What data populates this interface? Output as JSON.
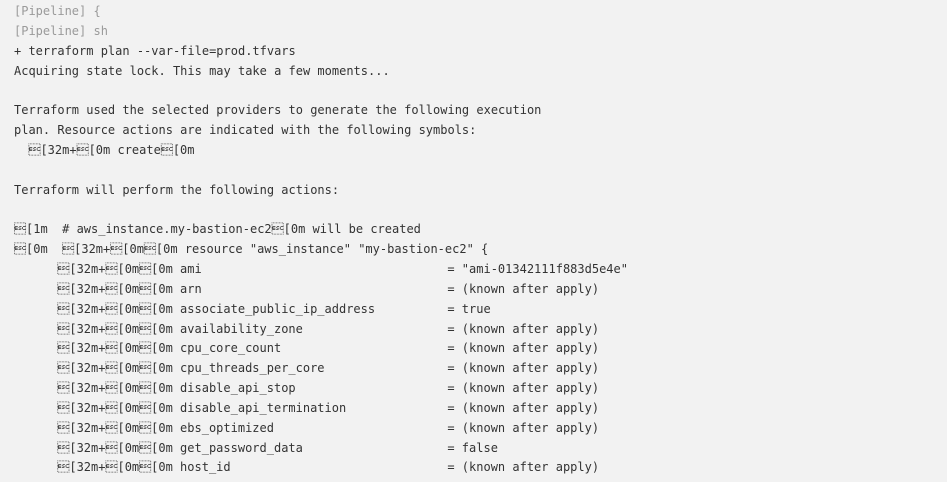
{
  "console": {
    "lines": [
      {
        "text": "[Pipeline] {",
        "muted": true
      },
      {
        "text": "[Pipeline] sh",
        "muted": true
      },
      {
        "text": "+ terraform plan --var-file=prod.tfvars",
        "muted": false
      },
      {
        "text": "Acquiring state lock. This may take a few moments...",
        "muted": false
      },
      {
        "text": "",
        "muted": false
      },
      {
        "text": "Terraform used the selected providers to generate the following execution",
        "muted": false
      },
      {
        "text": "plan. Resource actions are indicated with the following symbols:",
        "muted": false
      },
      {
        "text": "  \u001b[32m+\u001b[0m create\u001b[0m",
        "muted": false
      },
      {
        "text": "",
        "muted": false
      },
      {
        "text": "Terraform will perform the following actions:",
        "muted": false
      },
      {
        "text": "",
        "muted": false
      },
      {
        "text": "\u001b[1m  # aws_instance.my-bastion-ec2\u001b[0m will be created",
        "muted": false
      },
      {
        "text": "\u001b[0m  \u001b[32m+\u001b[0m\u001b[0m resource \"aws_instance\" \"my-bastion-ec2\" {",
        "muted": false
      },
      {
        "text": "      \u001b[32m+\u001b[0m\u001b[0m ami                                  = \"ami-01342111f883d5e4e\"",
        "muted": false
      },
      {
        "text": "      \u001b[32m+\u001b[0m\u001b[0m arn                                  = (known after apply)",
        "muted": false
      },
      {
        "text": "      \u001b[32m+\u001b[0m\u001b[0m associate_public_ip_address          = true",
        "muted": false
      },
      {
        "text": "      \u001b[32m+\u001b[0m\u001b[0m availability_zone                    = (known after apply)",
        "muted": false
      },
      {
        "text": "      \u001b[32m+\u001b[0m\u001b[0m cpu_core_count                       = (known after apply)",
        "muted": false
      },
      {
        "text": "      \u001b[32m+\u001b[0m\u001b[0m cpu_threads_per_core                 = (known after apply)",
        "muted": false
      },
      {
        "text": "      \u001b[32m+\u001b[0m\u001b[0m disable_api_stop                     = (known after apply)",
        "muted": false
      },
      {
        "text": "      \u001b[32m+\u001b[0m\u001b[0m disable_api_termination              = (known after apply)",
        "muted": false
      },
      {
        "text": "      \u001b[32m+\u001b[0m\u001b[0m ebs_optimized                        = (known after apply)",
        "muted": false
      },
      {
        "text": "      \u001b[32m+\u001b[0m\u001b[0m get_password_data                    = false",
        "muted": false
      },
      {
        "text": "      \u001b[32m+\u001b[0m\u001b[0m host_id                              = (known after apply)",
        "muted": false
      }
    ]
  }
}
